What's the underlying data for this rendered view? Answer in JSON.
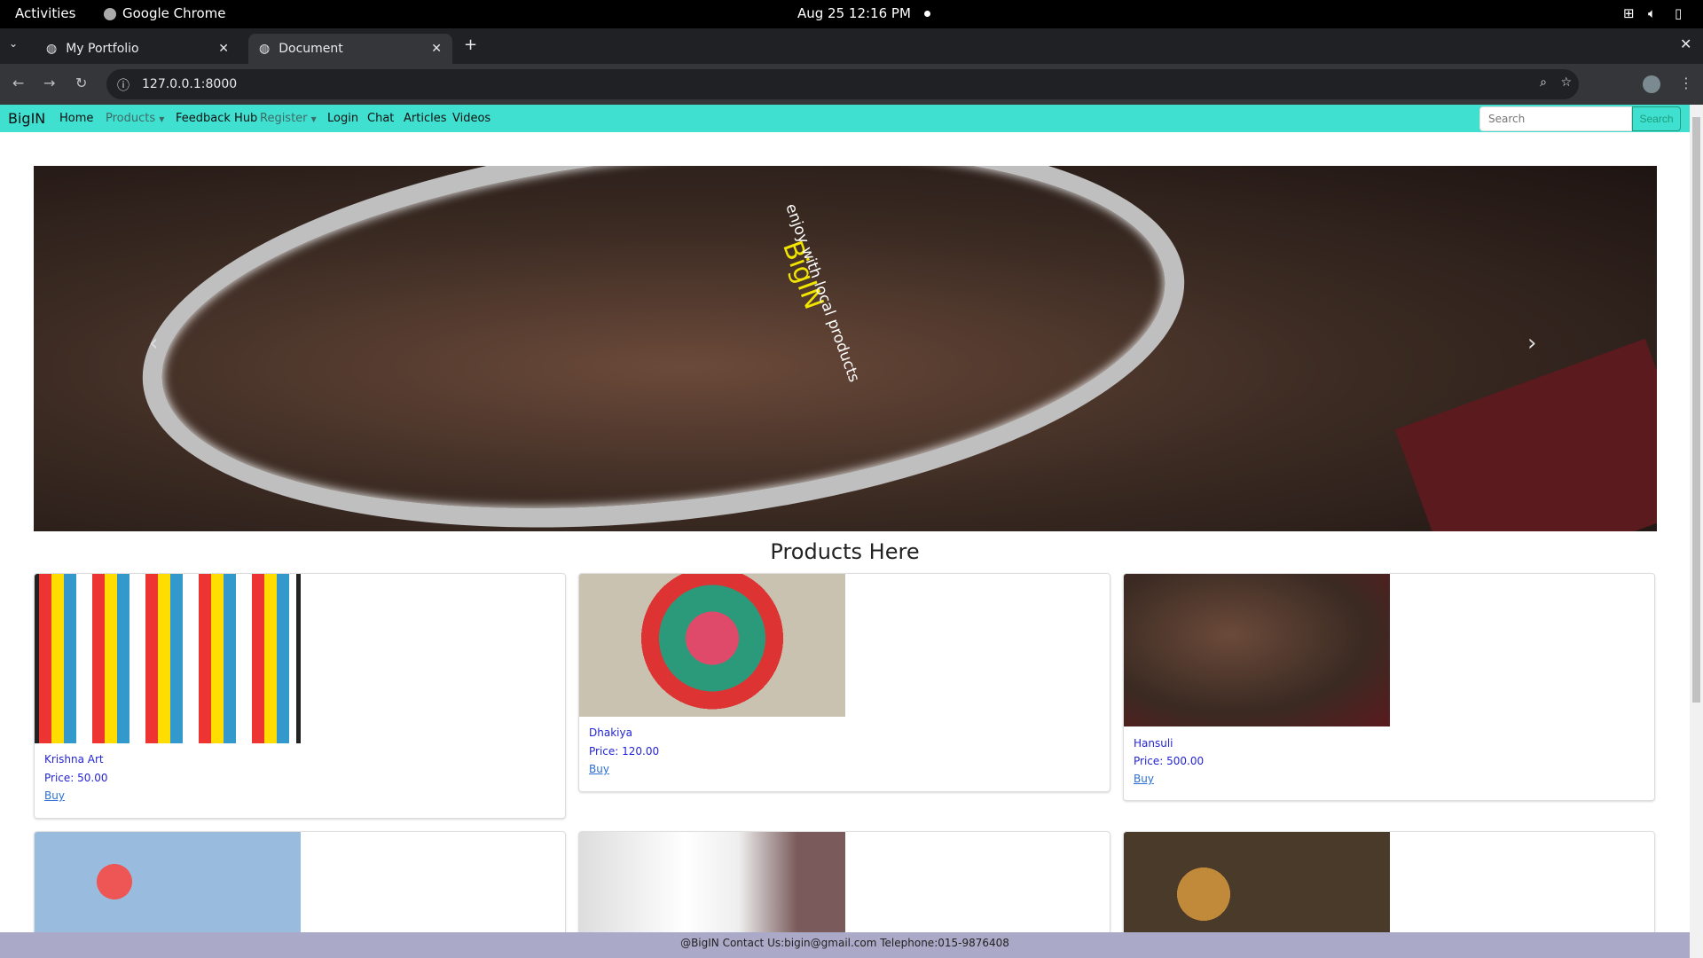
{
  "system_bar": {
    "activities": "Activities",
    "app": "Google Chrome",
    "datetime": "Aug 25  12:16 PM"
  },
  "browser": {
    "tabs": [
      {
        "title": "My Portfolio",
        "active": false
      },
      {
        "title": "Document",
        "active": true
      }
    ],
    "url": "127.0.0.1:8000"
  },
  "navbar": {
    "brand": "BigIN",
    "items": [
      {
        "label": "Home"
      },
      {
        "label": "Products",
        "dropdown": true
      },
      {
        "label": "Feedback Hub"
      },
      {
        "label": "Register",
        "dropdown": true
      },
      {
        "label": "Login"
      },
      {
        "label": "Chat"
      },
      {
        "label": "Articles"
      },
      {
        "label": "Videos"
      }
    ],
    "search_placeholder": "Search",
    "search_button": "Search",
    "color": "#40e0d0"
  },
  "carousel": {
    "caption_title": "BigIN",
    "caption_text": "enjoy with local products"
  },
  "products": {
    "heading": "Products Here",
    "buy_label": "Buy",
    "items": [
      {
        "name": "Krishna Art",
        "price": "Price: 50.00"
      },
      {
        "name": "Dhakiya",
        "price": "Price: 120.00"
      },
      {
        "name": "Hansuli",
        "price": "Price: 500.00"
      }
    ]
  },
  "footer": {
    "text": "@BigIN Contact Us:bigin@gmail.com Telephone:015-9876408"
  }
}
